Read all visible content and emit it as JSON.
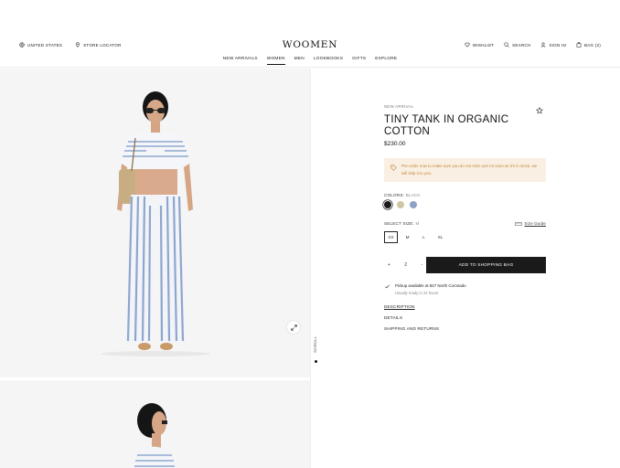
{
  "header": {
    "left": {
      "region": "UNITED STATES",
      "store": "STORE LOCATOR"
    },
    "logo": "WOOMEN",
    "right": {
      "wishlist": "WISHLIST",
      "search": "SEARCH",
      "signin": "SIGN IN",
      "bag": "BAG (2)"
    },
    "nav": [
      "NEW ARRIVALS",
      "WOMEN",
      "MEN",
      "LOOKBOOKS",
      "GIFTS",
      "EXPLORE"
    ],
    "active_nav": "WOMEN"
  },
  "gallery": {
    "scroll_label": "SCROLL"
  },
  "product": {
    "eyebrow": "NEW ARRIVAL",
    "title": "TINY TANK IN ORGANIC COTTON",
    "price": "$230.00",
    "notice": "Pre-order now to make sure you do not miss out! As soon as it's in stock, we will ship it to you.",
    "colors_label": "COLORS:",
    "colors_value": "BLACK",
    "swatches": [
      "#1a1a1a",
      "#cfc6a4",
      "#8ea2c6"
    ],
    "size_label": "SELECT SIZE:",
    "size_value": "M",
    "size_guide": "Size Guide",
    "sizes": [
      "XS",
      "M",
      "L",
      "XL"
    ],
    "selected_size": "XS",
    "qty_minus": "+",
    "qty_value": "2",
    "qty_plus": "-",
    "add_to_bag": "ADD TO SHOPPING BAG",
    "pickup_line1": "Pickup available at 827 North Coronado",
    "pickup_line2": "Usually ready in 24 hours",
    "links": [
      "DESCRIPTION",
      "DETAILS",
      "SHIPPING AND RETURNS"
    ]
  }
}
